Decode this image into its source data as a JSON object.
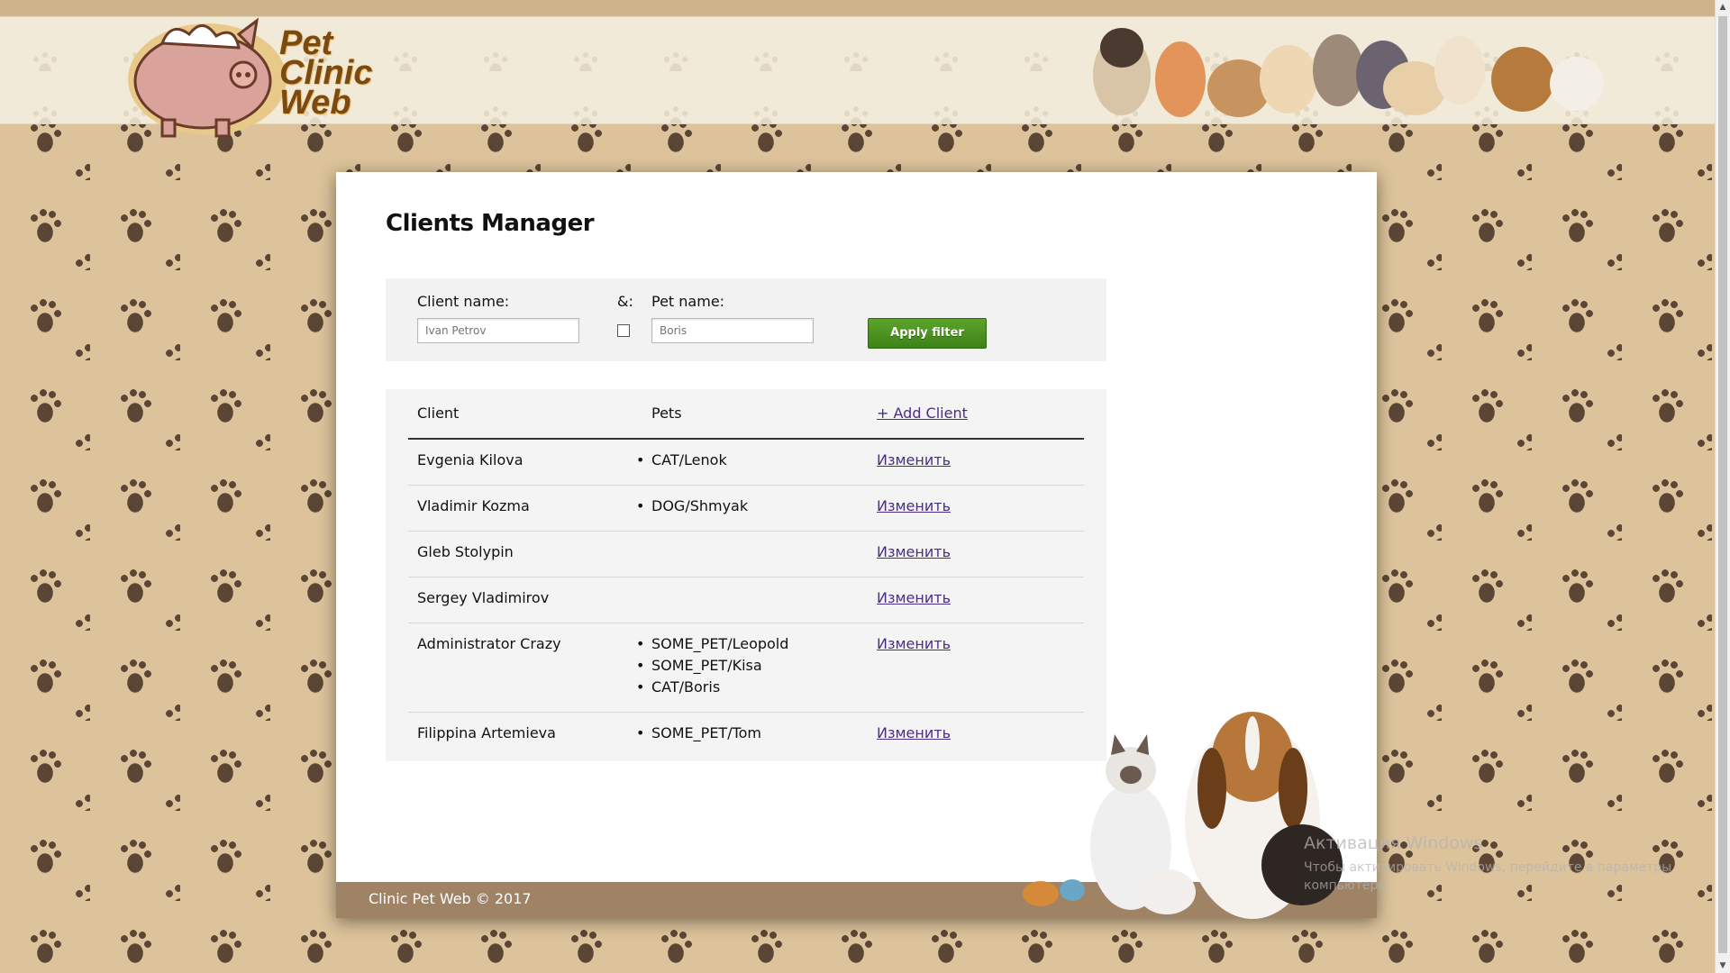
{
  "header": {
    "logo_text": "Pet\nClinic\nWeb",
    "logo_lines": [
      "Pet",
      "Clinic",
      "Web"
    ]
  },
  "page": {
    "title": "Clients Manager"
  },
  "filter": {
    "client_label": "Client name:",
    "client_placeholder": "Ivan Petrov",
    "and_label": "&:",
    "pet_label": "Pet name:",
    "pet_placeholder": "Boris",
    "apply_label": "Apply filter"
  },
  "table": {
    "headers": {
      "client": "Client",
      "pets": "Pets",
      "add_client": "+ Add Client"
    },
    "rows": [
      {
        "client": "Evgenia Kilova",
        "pets": [
          "CAT/Lenok"
        ],
        "edit": "Изменить"
      },
      {
        "client": "Vladimir Kozma",
        "pets": [
          "DOG/Shmyak"
        ],
        "edit": "Изменить"
      },
      {
        "client": "Gleb Stolypin",
        "pets": [],
        "edit": "Изменить"
      },
      {
        "client": "Sergey Vladimirov",
        "pets": [],
        "edit": "Изменить"
      },
      {
        "client": "Administrator Crazy",
        "pets": [
          "SOME_PET/Leopold",
          "SOME_PET/Kisa",
          "CAT/Boris"
        ],
        "edit": "Изменить"
      },
      {
        "client": "Filippina Artemieva",
        "pets": [
          "SOME_PET/Tom"
        ],
        "edit": "Изменить"
      }
    ]
  },
  "footer": {
    "text": "Clinic Pet Web © 2017"
  },
  "watermark": {
    "title": "Активация Windows",
    "subtitle": "Чтобы активировать Windows, перейдите в параметры компьютера."
  },
  "colors": {
    "background": "#dcc39b",
    "paw": "#5b4636",
    "header_band": "#f2ead9",
    "footer": "#a08265",
    "button": "#4a9420",
    "link": "#4b2d86"
  },
  "icons": {
    "logo": "pig-mascot-icon",
    "header_art": "pets-group-illustration",
    "footer_art": "dog-cat-rabbit-illustration"
  }
}
